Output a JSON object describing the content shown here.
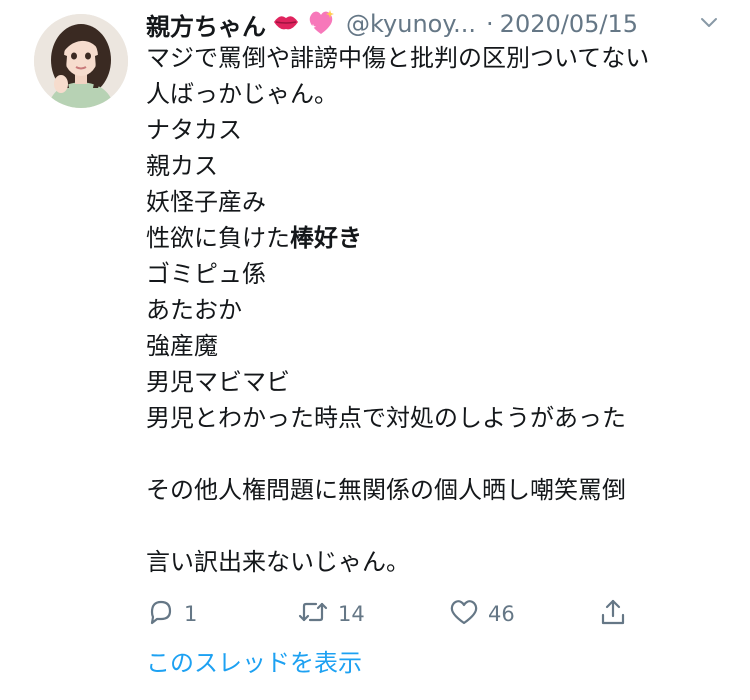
{
  "tweet": {
    "display_name": "親方ちゃん",
    "handle": "@kyunoy...",
    "separator": "·",
    "date": "2020/05/15",
    "lines": [
      "マジで罵倒や誹謗中傷と批判の区別ついてない",
      "人ばっかじゃん。",
      "ナタカス",
      "親カス",
      "妖怪子産み"
    ],
    "line_bold_prefix": "性欲に負けた",
    "line_bold_word": "棒好き",
    "lines2": [
      "ゴミピュ係",
      "あたおか",
      "強産魔",
      "男児マビマビ",
      "男児とわかった時点で対処のしようがあった"
    ],
    "line_after_blank": "その他人権問題に無関係の個人晒し嘲笑罵倒",
    "closing_line": "言い訳出来ないじゃん。"
  },
  "actions": {
    "reply_count": "1",
    "retweet_count": "14",
    "like_count": "46"
  },
  "show_thread_label": "このスレッドを表示",
  "icons": {
    "avatar": "avatar",
    "emoji1": "lips-emoji",
    "emoji2": "sparkling-heart-emoji",
    "menu": "chevron-down-icon",
    "reply": "reply-icon",
    "retweet": "retweet-icon",
    "like": "heart-icon",
    "share": "share-icon"
  },
  "colors": {
    "text": "#14171a",
    "secondary": "#657786",
    "link": "#1da1f2"
  }
}
